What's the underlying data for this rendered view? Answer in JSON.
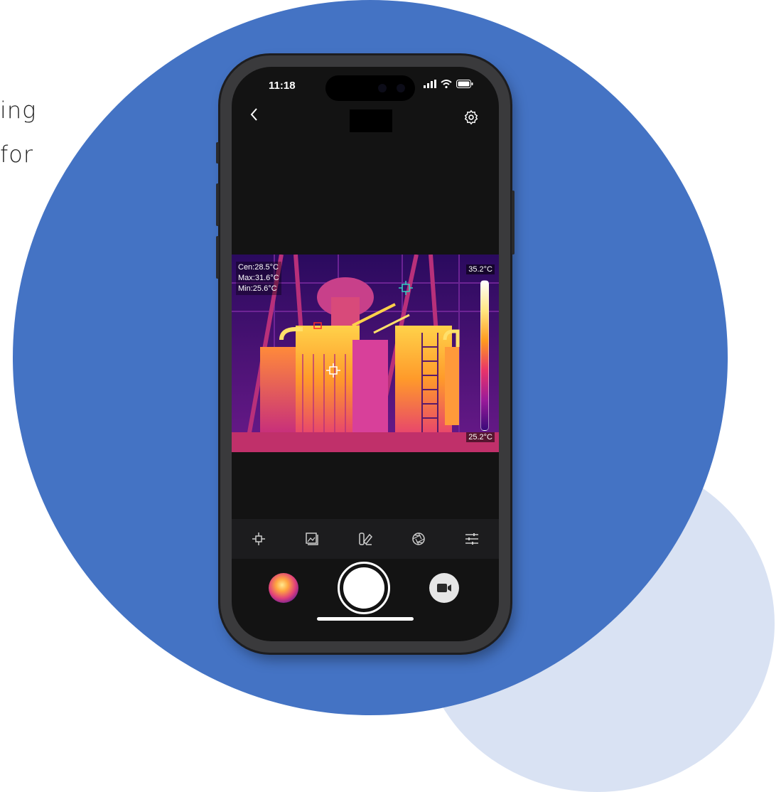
{
  "page": {
    "side_text": [
      "ing",
      "for"
    ]
  },
  "colors": {
    "accent_circle": "#4473c4",
    "light_circle": "#d9e2f3",
    "screen_bg": "#131313"
  },
  "status_bar": {
    "time": "11:18",
    "icons": [
      "signal-icon",
      "wifi-icon",
      "battery-icon"
    ]
  },
  "header": {
    "back_icon": "chevron-left-icon",
    "settings_icon": "gear-icon"
  },
  "thermal_view": {
    "readouts": {
      "center": "Cen:28.5°C",
      "max": "Max:31.6°C",
      "min": "Min:25.6°C"
    },
    "scale_max": "35.2°C",
    "scale_min": "25.2°C",
    "palette": "iron"
  },
  "toolbar": {
    "items": [
      {
        "name": "crosshair-icon"
      },
      {
        "name": "gallery-icon"
      },
      {
        "name": "palette-icon"
      },
      {
        "name": "aperture-icon"
      },
      {
        "name": "sliders-icon"
      }
    ]
  },
  "capture_bar": {
    "thumbnail": "last-capture-thumbnail",
    "shutter": "shutter-button",
    "video": "video-camera-icon"
  }
}
